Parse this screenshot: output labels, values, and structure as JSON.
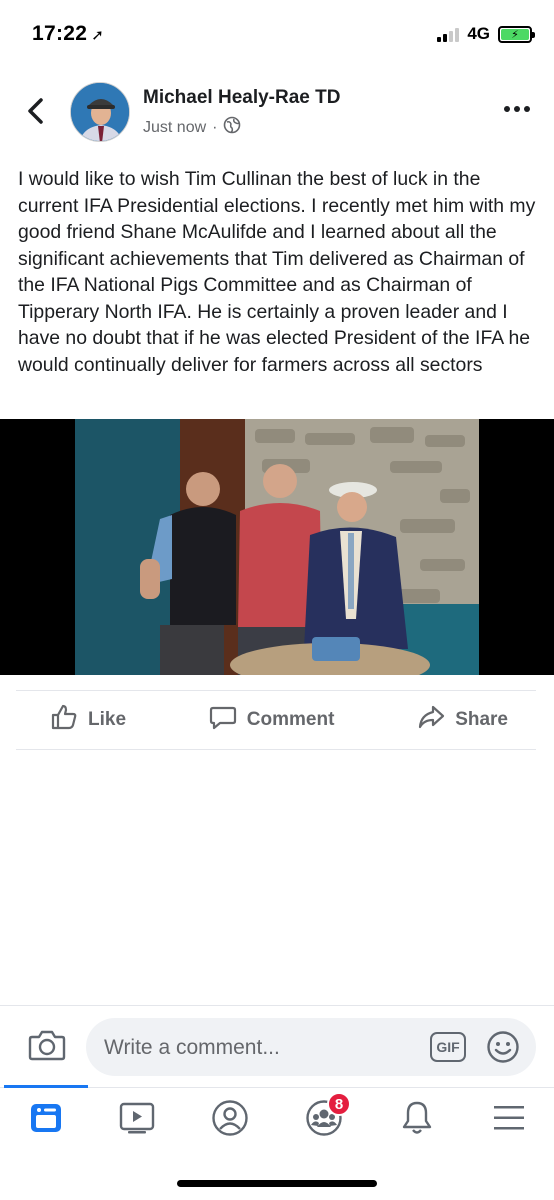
{
  "status_bar": {
    "time": "17:22",
    "network": "4G"
  },
  "post": {
    "author": "Michael Healy-Rae TD",
    "timestamp": "Just now",
    "separator": "·",
    "text": "I would like to wish Tim Cullinan the best of luck in the current IFA Presidential elections. I recently met him with my good friend Shane McAulifde and I learned about all the significant achievements that Tim delivered as Chairman of the IFA National Pigs Committee and as Chairman of Tipperary North IFA. He is certainly a proven leader and I have no doubt that if he was elected President of the IFA he would continually deliver for farmers across all sectors"
  },
  "actions": {
    "like": "Like",
    "comment": "Comment",
    "share": "Share"
  },
  "comment_bar": {
    "placeholder": "Write a comment...",
    "gif_label": "GIF"
  },
  "bottom_nav": {
    "groups_badge": "8",
    "items": [
      "news-feed-icon",
      "watch-icon",
      "profile-icon",
      "groups-icon",
      "notifications-icon",
      "menu-icon"
    ]
  },
  "colors": {
    "accent": "#1877f2",
    "badge": "#e41e3f",
    "muted": "#65676b",
    "battery": "#4cd964"
  }
}
